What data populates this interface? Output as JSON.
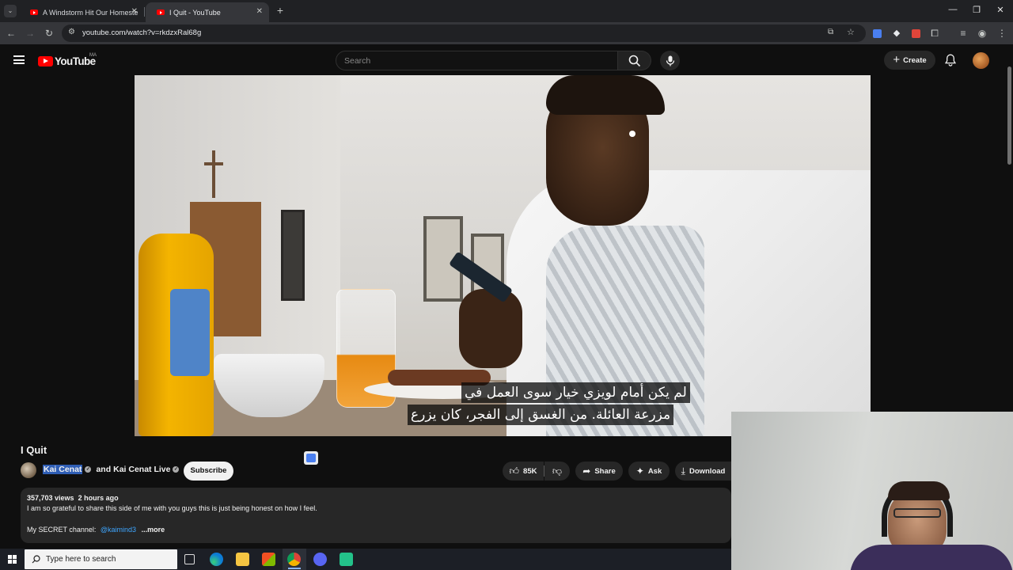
{
  "browser": {
    "tabs": [
      {
        "title": "A Windstorm Hit Our Homeste",
        "active": false
      },
      {
        "title": "I Quit - YouTube",
        "active": true
      }
    ],
    "url": "youtube.com/watch?v=rkdzxRal68g"
  },
  "youtube": {
    "logo_text": "YouTube",
    "region_badge": "MA",
    "search_placeholder": "Search",
    "create_label": "Create"
  },
  "video": {
    "caption_line1": "لم يكن أمام لويزي خيار سوى العمل في",
    "caption_line2": "مزرعة العائلة.  من الغسق إلى الفجر، كان يزرع"
  },
  "watch": {
    "title": "I Quit",
    "channel": "Kai Cenat",
    "collab_and": "and",
    "collab_channel": "Kai Cenat Live",
    "subscribe_label": "Subscribe",
    "likes": "85K",
    "share_label": "Share",
    "ask_label": "Ask",
    "download_label": "Download",
    "views": "357,703 views",
    "published": "2 hours ago",
    "description": "I am so grateful to share this side of me with you guys this is just being honest on how I feel.",
    "secret_label": "My SECRET channel:",
    "secret_link": "@kaimind3",
    "more_label": "...more"
  },
  "taskbar": {
    "search_placeholder": "Type here to search"
  },
  "colors": {
    "accent_red": "#ff0000",
    "link_blue": "#3ea6ff",
    "background": "#0f0f0f"
  }
}
